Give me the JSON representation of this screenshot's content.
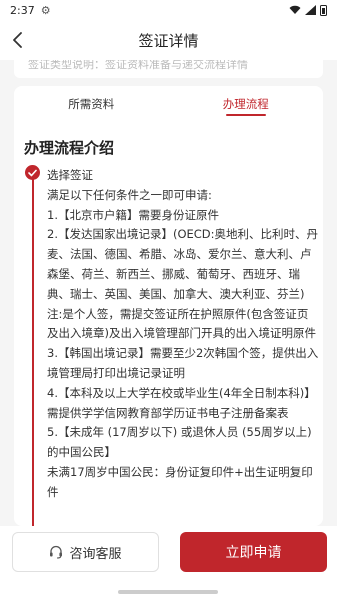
{
  "status_bar": {
    "time": "2:37"
  },
  "nav": {
    "title": "签证详情"
  },
  "top_card": {
    "faded_text": "签证类型说明：签证资料准备与递交流程详情"
  },
  "tabs": [
    {
      "label": "所需资料"
    },
    {
      "label": "办理流程"
    }
  ],
  "section": {
    "title": "办理流程介绍"
  },
  "step": {
    "title": "选择签证",
    "lines": [
      "满足以下任何条件之一即可申请:",
      "1.【北京市户籍】需要身份证原件",
      "2.【发达国家出境记录】(OECD:奥地利、比利时、丹麦、法国、德国、希腊、冰岛、爱尔兰、意大利、卢森堡、荷兰、新西兰、挪威、葡萄牙、西班牙、瑞典、瑞士、英国、美国、加拿大、澳大利亚、芬兰)",
      "注:是个人签，需提交签证所在护照原件(包含签证页及出入境章)及出入境管理部门开具的出入境证明原件",
      "3.【韩国出境记录】需要至少2次韩国个签，提供出入境管理局打印出境记录证明",
      "4.【本科及以上大学在校或毕业生(4年全日制本科)】需提供学学信网教育部学历证书电子注册备案表",
      "5.【未成年 (17周岁以下) 或退休人员 (55周岁以上)的中国公民】",
      "未满17周岁中国公民：身份证复印件+出生证明复印件"
    ]
  },
  "bottom": {
    "consult_label": "咨询客服",
    "apply_label": "立即申请"
  },
  "colors": {
    "accent": "#c0262c"
  }
}
